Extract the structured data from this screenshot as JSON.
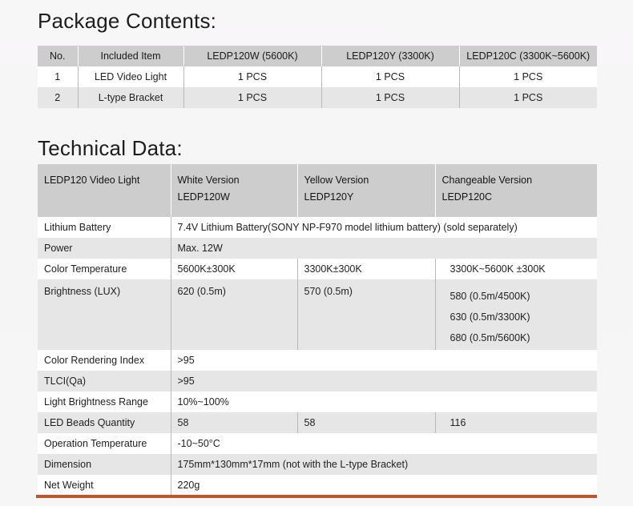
{
  "sections": {
    "package_title": "Package Contents:",
    "technical_title": "Technical Data:"
  },
  "package_table": {
    "headers": [
      "No.",
      "Included Item",
      "LEDP120W (5600K)",
      "LEDP120Y (3300K)",
      "LEDP120C (3300K~5600K)"
    ],
    "rows": [
      {
        "no": "1",
        "item": "LED Video Light",
        "w": "1 PCS",
        "y": "1 PCS",
        "c": "1 PCS"
      },
      {
        "no": "2",
        "item": "L-type Bracket",
        "w": "1 PCS",
        "y": "1 PCS",
        "c": "1 PCS"
      }
    ]
  },
  "tech_table": {
    "header": {
      "label": "LEDP120 Video Light",
      "white_version": "White Version",
      "white_model": "LEDP120W",
      "yellow_version": "Yellow Version",
      "yellow_model": "LEDP120Y",
      "changeable_version": "Changeable Version",
      "changeable_model": "LEDP120C"
    },
    "rows": {
      "battery": {
        "label": "Lithium Battery",
        "value": "7.4V Lithium Battery(SONY NP-F970 model lithium battery)  (sold separately)"
      },
      "power": {
        "label": "Power",
        "value": "Max. 12W"
      },
      "color_temp": {
        "label": "Color Temperature",
        "w": "5600K±300K",
        "y": "3300K±300K",
        "c": "3300K~5600K ±300K"
      },
      "brightness": {
        "label": "Brightness (LUX)",
        "w": "620 (0.5m)",
        "y": "570 (0.5m)",
        "c1": "580 (0.5m/4500K)",
        "c2": "630 (0.5m/3300K)",
        "c3": "680 (0.5m/5600K)"
      },
      "cri": {
        "label": "Color Rendering Index",
        "value": ">95"
      },
      "tlci": {
        "label": "TLCI(Qa)",
        "value": ">95"
      },
      "brightness_range": {
        "label": "Light Brightness Range",
        "value": "10%~100%"
      },
      "beads": {
        "label": "LED Beads Quantity",
        "w": "58",
        "y": "58",
        "c": "116"
      },
      "op_temp": {
        "label": "Operation Temperature",
        "value": "-10~50°C"
      },
      "dimension": {
        "label": "Dimension",
        "value": "175mm*130mm*17mm (not with the L-type Bracket)"
      },
      "weight": {
        "label": "Net Weight",
        "value": "220g"
      }
    }
  },
  "colors": {
    "accent_rule": "#c0562e",
    "table_header_bg": "#cdcdcd",
    "row_alt_bg": "#e6e6e6",
    "page_bg": "#f7f6f7"
  }
}
